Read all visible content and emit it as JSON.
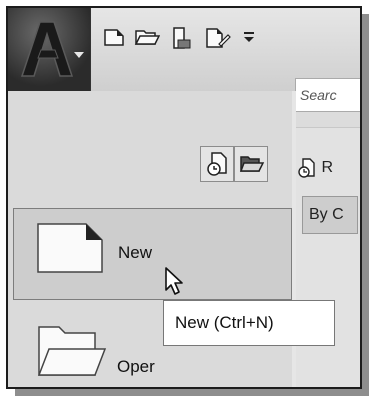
{
  "qat": {
    "icons": [
      "new-document-icon",
      "open-folder-icon",
      "save-icon",
      "save-as-icon",
      "customize-dropdown-icon"
    ]
  },
  "search": {
    "placeholder": "Searc"
  },
  "left_panel": {
    "view_toggles": [
      "recent-documents-icon",
      "open-documents-icon"
    ],
    "items": [
      {
        "label": "New",
        "icon": "new-document-icon"
      },
      {
        "label": "Oper",
        "icon": "open-folder-icon"
      }
    ]
  },
  "right_panel": {
    "heading": "R",
    "sort_label": "By C"
  },
  "tooltip": {
    "text": "New (Ctrl+N)"
  },
  "colors": {
    "panel": "#dadada",
    "hover": "#cdcdcd",
    "border": "#1c1c1c"
  }
}
